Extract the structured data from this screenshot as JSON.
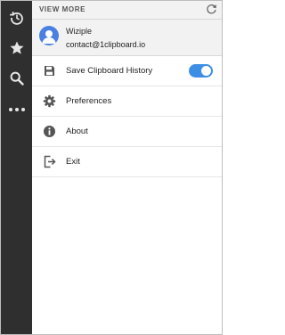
{
  "header": {
    "title": "VIEW MORE",
    "refresh_icon": "refresh-icon"
  },
  "rail": {
    "items": [
      {
        "name": "history",
        "icon": "history-icon"
      },
      {
        "name": "favorites",
        "icon": "star-icon"
      },
      {
        "name": "search",
        "icon": "search-icon"
      },
      {
        "name": "more",
        "icon": "more-icon"
      }
    ],
    "background": "#2f2f2f"
  },
  "user": {
    "name": "Wiziple",
    "email": "contact@1clipboard.io",
    "avatar_color": "#4b7fe1"
  },
  "menu": {
    "save_history": {
      "label": "Save Clipboard History",
      "icon": "save-icon",
      "toggle_on": true
    },
    "preferences": {
      "label": "Preferences",
      "icon": "gear-icon"
    },
    "about": {
      "label": "About",
      "icon": "info-icon"
    },
    "exit": {
      "label": "Exit",
      "icon": "exit-icon"
    }
  },
  "colors": {
    "accent": "#3d8fe6",
    "text": "#222222"
  }
}
